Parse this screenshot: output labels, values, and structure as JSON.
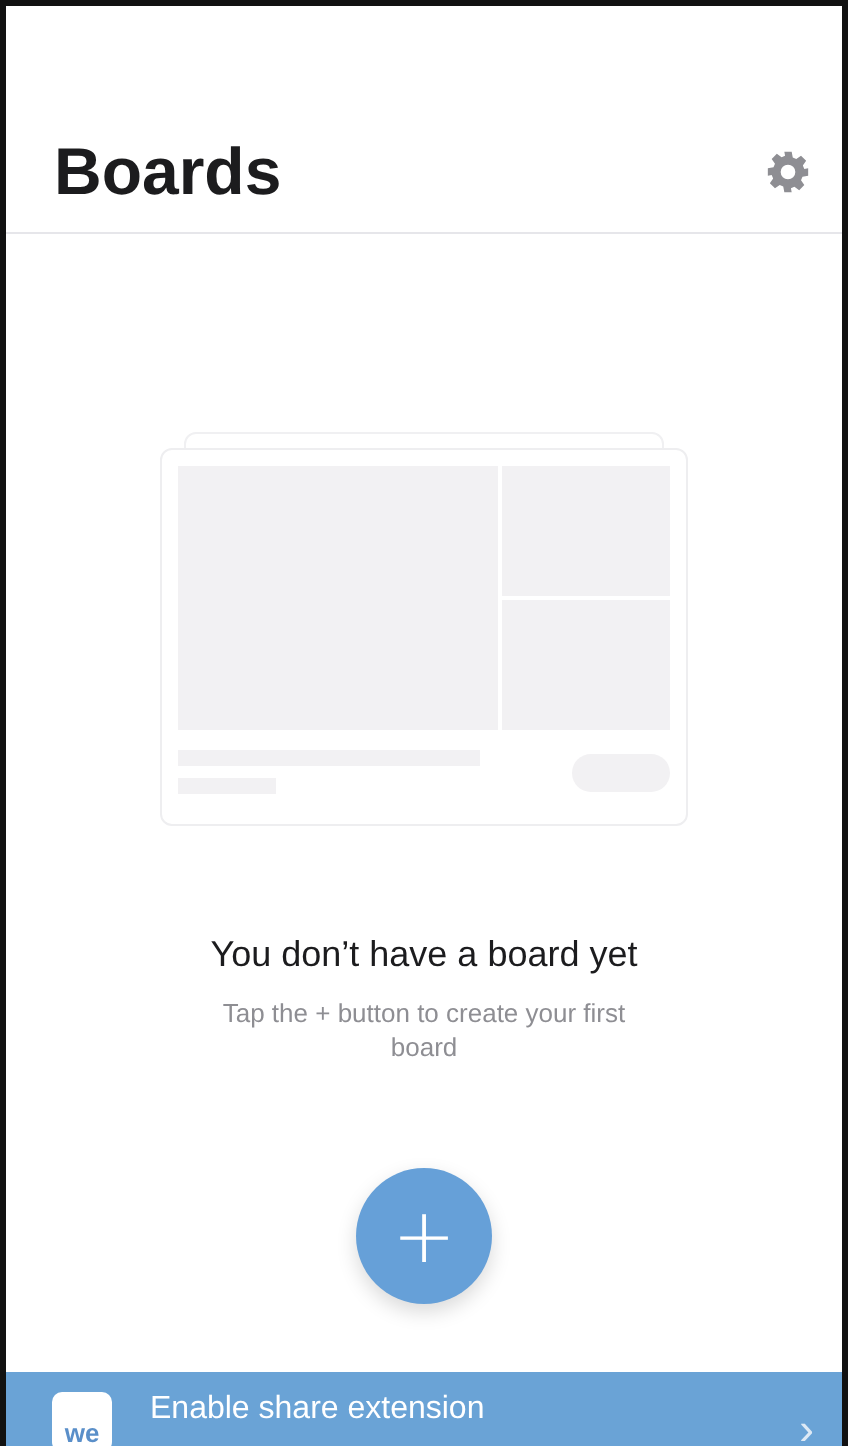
{
  "header": {
    "title": "Boards"
  },
  "empty_state": {
    "heading": "You don’t have a board yet",
    "message": "Tap the + button to create your first board"
  },
  "add_button": {
    "label": "+"
  },
  "banner": {
    "logo": "we",
    "title": "Enable share extension",
    "chevron": "›"
  }
}
